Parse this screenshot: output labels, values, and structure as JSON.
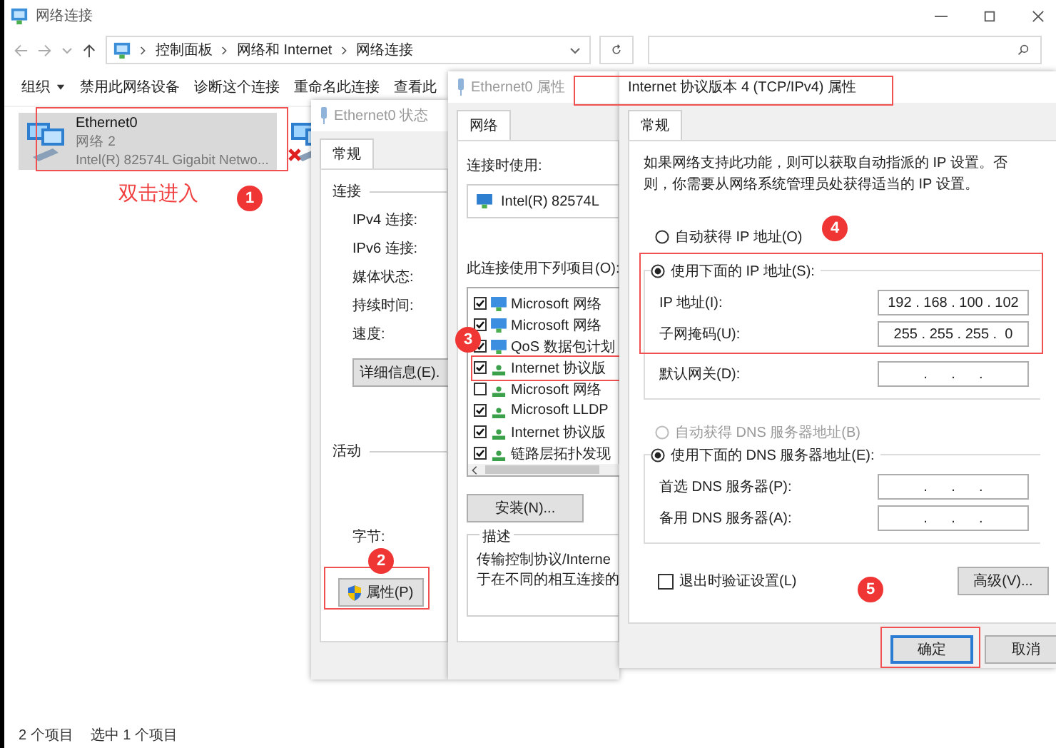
{
  "explorer": {
    "title": "网络连接",
    "breadcrumb": [
      "控制面板",
      "网络和 Internet",
      "网络连接"
    ],
    "toolbar": [
      {
        "label": "组织",
        "dropdown": true
      },
      {
        "label": "禁用此网络设备",
        "dropdown": false
      },
      {
        "label": "诊断这个连接",
        "dropdown": false
      },
      {
        "label": "重命名此连接",
        "dropdown": false
      },
      {
        "label": "查看此",
        "dropdown": false
      }
    ],
    "items": [
      {
        "name": "Ethernet0",
        "network": "网络 2",
        "adapter": "Intel(R) 82574L Gigabit Netwo...",
        "selected": true,
        "disconnected": false
      },
      {
        "selected": false,
        "disconnected": true
      }
    ],
    "status_bar": [
      "2 个项目",
      "选中 1 个项目"
    ]
  },
  "status_dialog": {
    "title": "Ethernet0 状态",
    "tabs": [
      {
        "label": "常规",
        "selected": true
      }
    ],
    "connection_heading": "连接",
    "labels": [
      "IPv4 连接:",
      "IPv6 连接:",
      "媒体状态:",
      "持续时间:",
      "速度:"
    ],
    "details_button": "详细信息(E).",
    "activity_heading": "活动",
    "bytes_label": "字节:",
    "properties_button": "属性(P)"
  },
  "properties_dialog": {
    "title": "Ethernet0 属性",
    "tabs": [
      {
        "label": "网络",
        "selected": true
      }
    ],
    "connect_using_label": "连接时使用:",
    "adapter": "Intel(R) 82574L",
    "items_label": "此连接使用下列项目(O):",
    "components": [
      {
        "label": "Microsoft 网络",
        "checked": true,
        "kind": "network"
      },
      {
        "label": "Microsoft 网络",
        "checked": true,
        "kind": "network"
      },
      {
        "label": "QoS 数据包计划",
        "checked": true,
        "kind": "network"
      },
      {
        "label": "Internet 协议版",
        "checked": true,
        "kind": "protocol"
      },
      {
        "label": "Microsoft 网络",
        "checked": false,
        "kind": "protocol"
      },
      {
        "label": "Microsoft LLDP",
        "checked": true,
        "kind": "protocol"
      },
      {
        "label": "Internet 协议版",
        "checked": true,
        "kind": "protocol"
      },
      {
        "label": "链路层拓扑发现",
        "checked": true,
        "kind": "protocol"
      }
    ],
    "install_button": "安装(N)...",
    "description_heading": "描述",
    "description_lines": [
      "传输控制协议/Interne",
      "于在不同的相互连接的"
    ]
  },
  "ipv4_dialog": {
    "title": "Internet 协议版本 4 (TCP/IPv4) 属性",
    "tabs": [
      {
        "label": "常规",
        "selected": true
      }
    ],
    "intro": "如果网络支持此功能，则可以获取自动指派的 IP 设置。否则，你需要从网络系统管理员处获得适当的 IP 设置。",
    "ip_modes": [
      {
        "label": "自动获得 IP 地址(O)",
        "selected": false,
        "disabled": false
      },
      {
        "label": "使用下面的 IP 地址(S):",
        "selected": true,
        "disabled": false
      }
    ],
    "ip_fields": [
      {
        "label": "IP 地址(I):",
        "value": "192 . 168 . 100 . 102"
      },
      {
        "label": "子网掩码(U):",
        "value": "255 . 255 . 255 .  0"
      },
      {
        "label": "默认网关(D):",
        "value": ".      .      ."
      }
    ],
    "dns_modes": [
      {
        "label": "自动获得 DNS 服务器地址(B)",
        "selected": false,
        "disabled": true
      },
      {
        "label": "使用下面的 DNS 服务器地址(E):",
        "selected": true,
        "disabled": false
      }
    ],
    "dns_fields": [
      {
        "label": "首选 DNS 服务器(P):",
        "value": ".      .      ."
      },
      {
        "label": "备用 DNS 服务器(A):",
        "value": ".      .      ."
      }
    ],
    "validate": {
      "label": "退出时验证设置(L)",
      "checked": false
    },
    "advanced_button": "高级(V)...",
    "buttons": [
      {
        "label": "确定",
        "default": true
      },
      {
        "label": "取消",
        "default": false
      }
    ]
  },
  "annotations": {
    "hint": "双击进入",
    "steps": [
      "1",
      "2",
      "3",
      "4",
      "5"
    ]
  }
}
